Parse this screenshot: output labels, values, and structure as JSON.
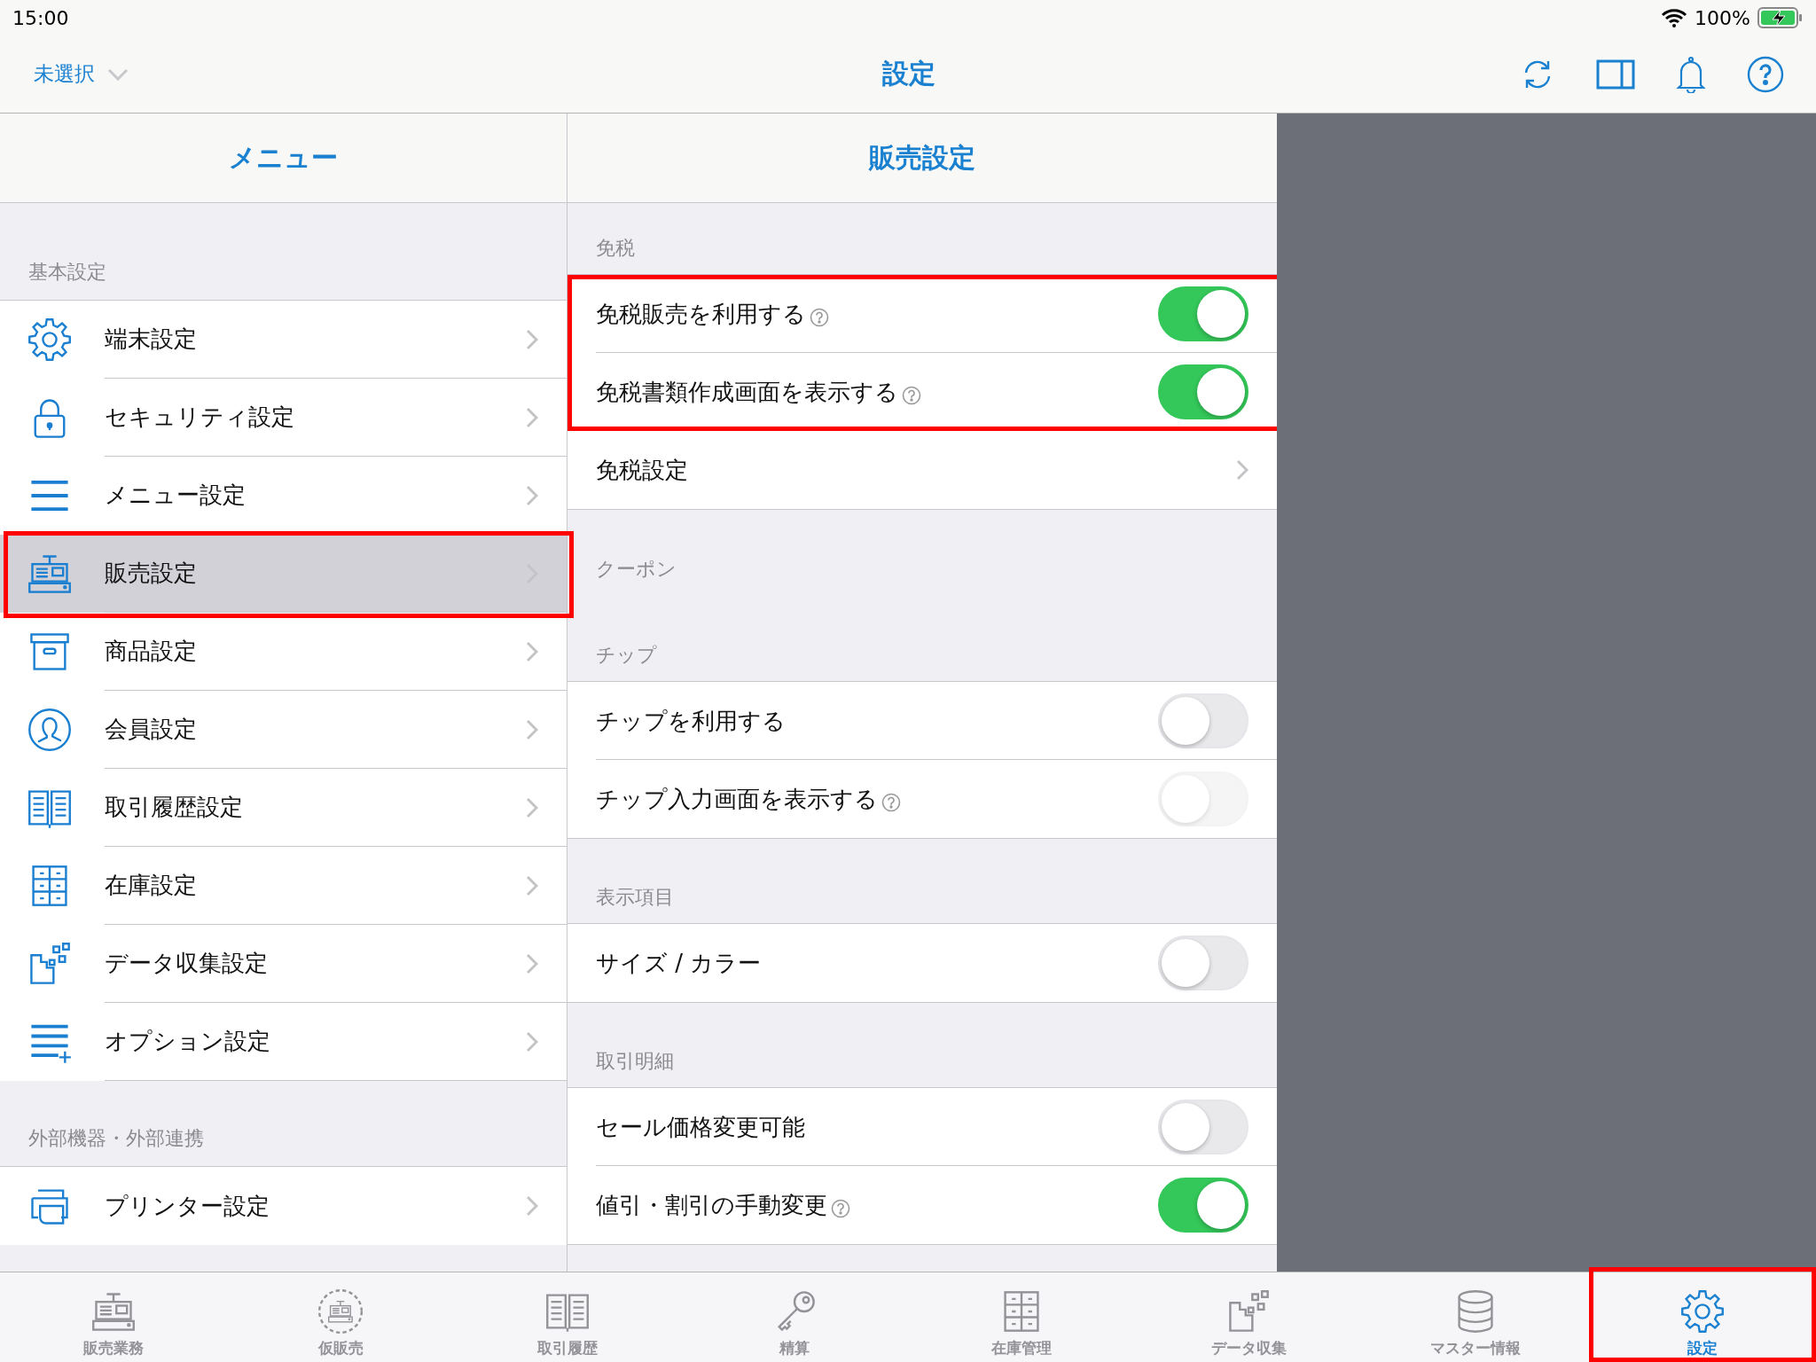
{
  "status_bar": {
    "time": "15:00",
    "battery": "100%",
    "charging": true
  },
  "nav": {
    "location": "未選択",
    "title": "設定"
  },
  "menu": {
    "title": "メニュー",
    "sections": [
      {
        "header": "基本設定",
        "items": [
          {
            "label": "端末設定",
            "selected": false,
            "highlighted": false
          },
          {
            "label": "セキュリティ設定",
            "selected": false,
            "highlighted": false
          },
          {
            "label": "メニュー設定",
            "selected": false,
            "highlighted": false
          },
          {
            "label": "販売設定",
            "selected": true,
            "highlighted": true
          },
          {
            "label": "商品設定",
            "selected": false,
            "highlighted": false
          },
          {
            "label": "会員設定",
            "selected": false,
            "highlighted": false
          },
          {
            "label": "取引履歴設定",
            "selected": false,
            "highlighted": false
          },
          {
            "label": "在庫設定",
            "selected": false,
            "highlighted": false
          },
          {
            "label": "データ収集設定",
            "selected": false,
            "highlighted": false
          },
          {
            "label": "オプション設定",
            "selected": false,
            "highlighted": false
          }
        ]
      },
      {
        "header": "外部機器・外部連携",
        "items": [
          {
            "label": "プリンター設定",
            "selected": false,
            "highlighted": false
          }
        ]
      }
    ]
  },
  "detail": {
    "title": "販売設定",
    "sections": [
      {
        "header": "免税",
        "rows": [
          {
            "kind": "toggle",
            "label": "免税販売を利用する",
            "help": true,
            "on": true,
            "disabled": false,
            "highlighted": true
          },
          {
            "kind": "toggle",
            "label": "免税書類作成画面を表示する",
            "help": true,
            "on": true,
            "disabled": false,
            "highlighted": true
          },
          {
            "kind": "link",
            "label": "免税設定",
            "help": false,
            "highlighted": false
          }
        ]
      },
      {
        "header": "クーポン"
      },
      {
        "header": "チップ",
        "rows": [
          {
            "kind": "toggle",
            "label": "チップを利用する",
            "help": false,
            "on": false,
            "disabled": false,
            "highlighted": false
          },
          {
            "kind": "toggle",
            "label": "チップ入力画面を表示する",
            "help": true,
            "on": false,
            "disabled": true,
            "highlighted": false
          }
        ]
      },
      {
        "header": "表示項目",
        "rows": [
          {
            "kind": "toggle",
            "label": "サイズ / カラー",
            "help": false,
            "on": false,
            "disabled": false,
            "highlighted": false
          }
        ]
      },
      {
        "header": "取引明細",
        "rows": [
          {
            "kind": "toggle",
            "label": "セール価格変更可能",
            "help": false,
            "on": false,
            "disabled": false,
            "highlighted": false
          },
          {
            "kind": "toggle",
            "label": "値引・割引の手動変更",
            "help": true,
            "on": true,
            "disabled": false,
            "highlighted": false
          }
        ]
      }
    ]
  },
  "tabs": [
    {
      "label": "販売業務",
      "selected": false,
      "highlighted": false
    },
    {
      "label": "仮販売",
      "selected": false,
      "highlighted": false
    },
    {
      "label": "取引履歴",
      "selected": false,
      "highlighted": false
    },
    {
      "label": "精算",
      "selected": false,
      "highlighted": false
    },
    {
      "label": "在庫管理",
      "selected": false,
      "highlighted": false
    },
    {
      "label": "データ収集",
      "selected": false,
      "highlighted": false
    },
    {
      "label": "マスター情報",
      "selected": false,
      "highlighted": false
    },
    {
      "label": "設定",
      "selected": true,
      "highlighted": true
    }
  ]
}
